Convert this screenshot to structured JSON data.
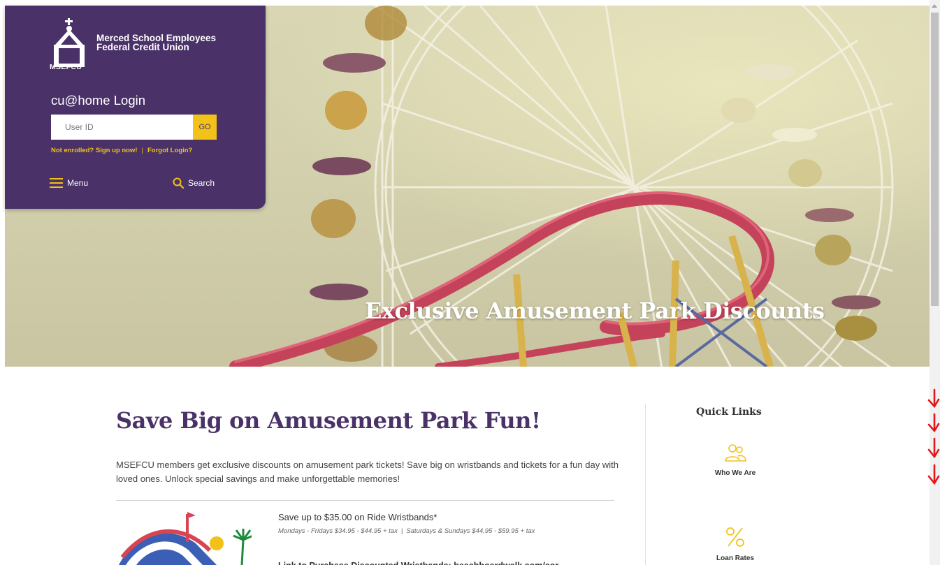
{
  "hero": {
    "title": "Exclusive Amusement Park Discounts"
  },
  "brand": {
    "name_line1": "Merced School Employees",
    "name_line2": "Federal Credit Union",
    "abbr": "MSEFCU",
    "primary_color": "#4a3268",
    "accent_color": "#f2c11a"
  },
  "login": {
    "title": "cu@home Login",
    "userid_placeholder": "User ID",
    "go_label": "GO",
    "enroll_link": "Not enrolled? Sign up now!",
    "separator": "|",
    "forgot_link": "Forgot Login?"
  },
  "nav": {
    "menu_label": "Menu",
    "menu_icon": "hamburger-icon",
    "search_label": "Search",
    "search_icon": "search-icon"
  },
  "main": {
    "heading": "Save Big on Amusement Park Fun!",
    "intro": "MSEFCU members get exclusive discounts on amusement park tickets! Save big on wristbands and tickets for a fun day with loved ones. Unlock special savings and make unforgettable memories!",
    "offer": {
      "title": "Save up to $35.00 on Ride Wristbands*",
      "weekday_pricing": "Mondays - Fridays $34.95 - $44.95 + tax",
      "pricing_separator": "|",
      "weekend_pricing": "Saturdays & Sundays $44.95 - $59.95 + tax",
      "link_text": "Link to Purchase Discounted Wristbands: beachboardwalk.com/cor..."
    }
  },
  "quick_links": {
    "title": "Quick Links",
    "items": [
      {
        "label": "Who We Are",
        "icon": "people-icon"
      },
      {
        "label": "Loan Rates",
        "icon": "percent-icon"
      }
    ]
  }
}
